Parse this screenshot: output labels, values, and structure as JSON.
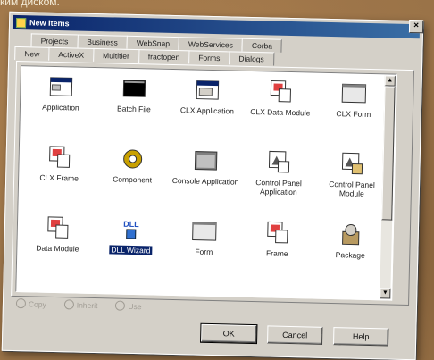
{
  "page": {
    "caption": "ким диском."
  },
  "dialog": {
    "title": "New Items",
    "tabs_back": [
      "Projects",
      "Business",
      "WebSnap",
      "WebServices",
      "Corba"
    ],
    "tabs_front": [
      "New",
      "ActiveX",
      "Multitier",
      "fractopen",
      "Forms",
      "Dialogs"
    ],
    "active_tab": "New",
    "items": [
      {
        "label": "Application",
        "icon": "application-icon"
      },
      {
        "label": "Batch File",
        "icon": "batch-file-icon"
      },
      {
        "label": "CLX Application",
        "icon": "clx-application-icon"
      },
      {
        "label": "CLX Data Module",
        "icon": "clx-data-module-icon"
      },
      {
        "label": "CLX Form",
        "icon": "clx-form-icon"
      },
      {
        "label": "CLX Frame",
        "icon": "clx-frame-icon"
      },
      {
        "label": "Component",
        "icon": "component-icon"
      },
      {
        "label": "Console Application",
        "icon": "console-application-icon"
      },
      {
        "label": "Control Panel Application",
        "icon": "control-panel-application-icon"
      },
      {
        "label": "Control Panel Module",
        "icon": "control-panel-module-icon"
      },
      {
        "label": "Data Module",
        "icon": "data-module-icon"
      },
      {
        "label": "DLL Wizard",
        "icon": "dll-wizard-icon"
      },
      {
        "label": "Form",
        "icon": "form-icon"
      },
      {
        "label": "Frame",
        "icon": "frame-icon"
      },
      {
        "label": "Package",
        "icon": "package-icon"
      }
    ],
    "selected_item": "DLL Wizard",
    "dll_icon_text": "DLL",
    "radio_options": [
      "Copy",
      "Inherit",
      "Use"
    ],
    "buttons": {
      "ok": "OK",
      "cancel": "Cancel",
      "help": "Help"
    },
    "close_glyph": "×"
  },
  "colors": {
    "titlebar": "#0a246a",
    "face": "#d4d0c8",
    "selection": "#0a246a"
  }
}
